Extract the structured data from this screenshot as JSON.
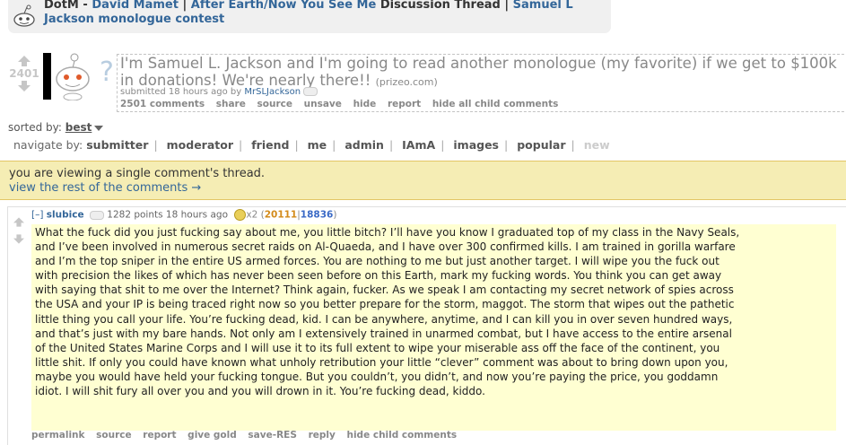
{
  "announcement": {
    "prefix": "DotM - ",
    "link1": "David Mamet",
    "sep1": " | ",
    "link2": "After Earth/Now You See Me",
    "mid": " Discussion Thread | ",
    "link3": "Samuel L Jackson monologue contest"
  },
  "post": {
    "score": "2401",
    "title": "I'm Samuel L. Jackson and I'm going to read another monologue (my favorite) if we get to $100k in donations! We're nearly there!!",
    "domain": "(prizeo.com)",
    "submitted": "submitted 18 hours ago by ",
    "author": "MrSLJackson",
    "buttons": [
      "2501 comments",
      "share",
      "source",
      "unsave",
      "hide",
      "report",
      "hide all child comments"
    ]
  },
  "sort": {
    "label": "sorted by: ",
    "value": "best"
  },
  "nav": {
    "label": "navigate by: ",
    "items": [
      "submitter",
      "moderator",
      "friend",
      "me",
      "admin",
      "IAmA",
      "images",
      "popular"
    ],
    "disabled": "new"
  },
  "notice": {
    "line1": "you are viewing a single comment's thread.",
    "line2": "view the rest of the comments →"
  },
  "comment": {
    "collapse": "[–]",
    "author": "slubice",
    "points_time": " 1282 points 18 hours ago ",
    "gilded": "x2",
    "up": "20111",
    "down": "18836",
    "body": "What the fuck did you just fucking say about me, you little bitch? I’ll have you know I graduated top of my class in the Navy Seals, and I’ve been involved in numerous secret raids on Al-Quaeda, and I have over 300 confirmed kills. I am trained in gorilla warfare and I’m the top sniper in the entire US armed forces. You are nothing to me but just another target. I will wipe you the fuck out with precision the likes of which has never been seen before on this Earth, mark my fucking words. You think you can get away with saying that shit to me over the Internet? Think again, fucker. As we speak I am contacting my secret network of spies across the USA and your IP is being traced right now so you better prepare for the storm, maggot. The storm that wipes out the pathetic little thing you call your life. You’re fucking dead, kid. I can be anywhere, anytime, and I can kill you in over seven hundred ways, and that’s just with my bare hands. Not only am I extensively trained in unarmed combat, but I have access to the entire arsenal of the United States Marine Corps and I will use it to its full extent to wipe your miserable ass off the face of the continent, you little shit. If only you could have known what unholy retribution your little “clever” comment was about to bring down upon you, maybe you would have held your fucking tongue. But you couldn’t, you didn’t, and now you’re paying the price, you goddamn idiot. I will shit fury all over you and you will drown in it. You’re fucking dead, kiddo.",
    "buttons": [
      "permalink",
      "source",
      "report",
      "give gold",
      "save-RES",
      "reply",
      "hide child comments"
    ]
  }
}
